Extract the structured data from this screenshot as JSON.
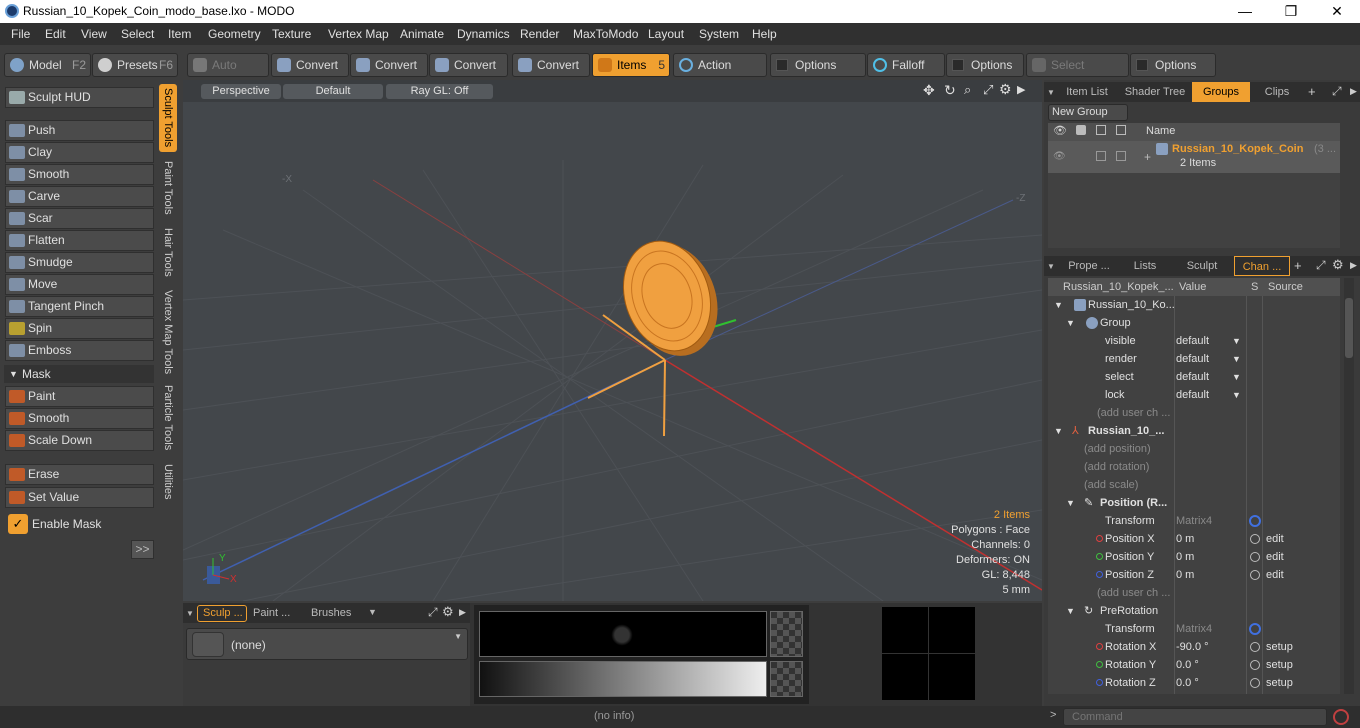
{
  "window": {
    "title": "Russian_10_Kopek_Coin_modo_base.lxo - MODO",
    "minimize": "—",
    "maximize": "❐",
    "close": "✕"
  },
  "menu": [
    "File",
    "Edit",
    "View",
    "Select",
    "Item",
    "Geometry",
    "Texture",
    "Vertex Map",
    "Animate",
    "Dynamics",
    "Render",
    "MaxToModo",
    "Layout",
    "System",
    "Help"
  ],
  "toolbar": {
    "model": "Model",
    "model_key": "F2",
    "presets": "Presets",
    "presets_key": "F6",
    "auto_select": "Auto Select",
    "convert": "Convert",
    "items": "Items",
    "items_key": "5",
    "action_center": "Action Center",
    "options": "Options",
    "falloff": "Falloff",
    "select_through": "Select Through"
  },
  "left": {
    "sculpt_hud": "Sculpt HUD",
    "tools": [
      "Push",
      "Clay",
      "Smooth",
      "Carve",
      "Scar",
      "Flatten",
      "Smudge",
      "Move",
      "Tangent Pinch",
      "Spin",
      "Emboss"
    ],
    "mask_header": "Mask",
    "mask_tools": [
      "Paint",
      "Smooth",
      "Scale Down"
    ],
    "extra_tools": [
      "Erase",
      "Set Value"
    ],
    "enable_mask": "Enable Mask",
    "more": ">>",
    "vtabs": [
      "Sculpt Tools",
      "Paint Tools",
      "Hair Tools",
      "Vertex Map Tools",
      "Particle Tools",
      "Utilities"
    ]
  },
  "viewport": {
    "view": "Perspective",
    "shading": "Default",
    "raygl": "Ray GL: Off",
    "axis_minus_x": "-X",
    "axis_minus_z": "-Z",
    "gizmo_y": "Y",
    "gizmo_x": "X",
    "info": {
      "items": "2 Items",
      "polygons": "Polygons : Face",
      "channels": "Channels: 0",
      "deformers": "Deformers: ON",
      "gl": "GL: 8,448",
      "scale": "5 mm"
    }
  },
  "bottom": {
    "tabs": [
      "Sculp ...",
      "Paint ...",
      "Brushes"
    ],
    "brush": "(none)"
  },
  "right": {
    "top_tabs": [
      "Item List",
      "Shader Tree",
      "Groups",
      "Clips"
    ],
    "new_group": "New Group",
    "name_col": "Name",
    "group_name": "Russian_10_Kopek_Coin",
    "group_suffix": "(3 ...",
    "group_count": "2 Items",
    "ch_tabs": [
      "Prope ...",
      "Lists",
      "Sculpt",
      "Chan ..."
    ],
    "ch_cols": [
      "Russian_10_Kopek_...",
      "Value",
      "S",
      "Source"
    ],
    "rows": [
      {
        "name": "Russian_10_Ko...",
        "value": "",
        "src": ""
      },
      {
        "name": "Group",
        "value": "",
        "src": ""
      },
      {
        "name": "visible",
        "value": "default",
        "src": ""
      },
      {
        "name": "render",
        "value": "default",
        "src": ""
      },
      {
        "name": "select",
        "value": "default",
        "src": ""
      },
      {
        "name": "lock",
        "value": "default",
        "src": ""
      },
      {
        "name": "(add user ch ...",
        "value": "",
        "src": ""
      },
      {
        "name": "Russian_10_...",
        "value": "",
        "src": ""
      },
      {
        "name": "(add position)",
        "value": "",
        "src": ""
      },
      {
        "name": "(add rotation)",
        "value": "",
        "src": ""
      },
      {
        "name": "(add scale)",
        "value": "",
        "src": ""
      },
      {
        "name": "Position (R...",
        "value": "",
        "src": ""
      },
      {
        "name": "Transform",
        "value": "Matrix4",
        "src": ""
      },
      {
        "name": "Position X",
        "value": "0 m",
        "src": "edit"
      },
      {
        "name": "Position Y",
        "value": "0 m",
        "src": "edit"
      },
      {
        "name": "Position Z",
        "value": "0 m",
        "src": "edit"
      },
      {
        "name": "(add user ch ...",
        "value": "",
        "src": ""
      },
      {
        "name": "PreRotation",
        "value": "",
        "src": ""
      },
      {
        "name": "Transform",
        "value": "Matrix4",
        "src": ""
      },
      {
        "name": "Rotation X",
        "value": "-90.0 °",
        "src": "setup"
      },
      {
        "name": "Rotation Y",
        "value": "0.0 °",
        "src": "setup"
      },
      {
        "name": "Rotation Z",
        "value": "0.0 °",
        "src": "setup"
      }
    ],
    "command_placeholder": "Command"
  },
  "status": {
    "info": "(no info)"
  }
}
